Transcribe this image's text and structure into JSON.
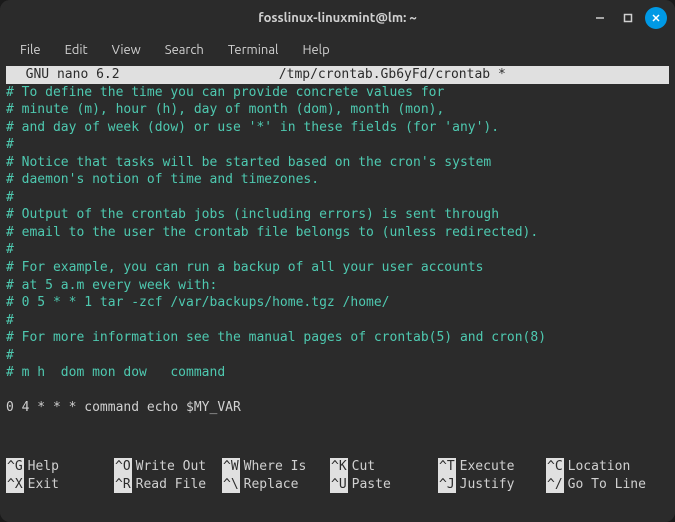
{
  "window": {
    "title": "fosslinux-linuxmint@lm: ~"
  },
  "menubar": {
    "file": "File",
    "edit": "Edit",
    "view": "View",
    "search": "Search",
    "terminal": "Terminal",
    "help": "Help"
  },
  "nano": {
    "version": "  GNU nano 6.2",
    "filepath": "/tmp/crontab.Gb6yFd/crontab *"
  },
  "lines": {
    "l0": "# To define the time you can provide concrete values for",
    "l1": "# minute (m), hour (h), day of month (dom), month (mon),",
    "l2": "# and day of week (dow) or use '*' in these fields (for 'any').",
    "l3": "#",
    "l4": "# Notice that tasks will be started based on the cron's system",
    "l5": "# daemon's notion of time and timezones.",
    "l6": "#",
    "l7": "# Output of the crontab jobs (including errors) is sent through",
    "l8": "# email to the user the crontab file belongs to (unless redirected).",
    "l9": "#",
    "l10": "# For example, you can run a backup of all your user accounts",
    "l11": "# at 5 a.m every week with:",
    "l12": "# 0 5 * * 1 tar -zcf /var/backups/home.tgz /home/",
    "l13": "#",
    "l14": "# For more information see the manual pages of crontab(5) and cron(8)",
    "l15": "#",
    "l16": "# m h  dom mon dow   command",
    "l17": "",
    "l18": "0 4 * * * command echo $MY_VAR"
  },
  "shortcuts": {
    "help_key": "^G",
    "help_desc": "Help",
    "writeout_key": "^O",
    "writeout_desc": "Write Out",
    "whereis_key": "^W",
    "whereis_desc": "Where Is",
    "cut_key": "^K",
    "cut_desc": "Cut",
    "execute_key": "^T",
    "execute_desc": "Execute",
    "location_key": "^C",
    "location_desc": "Location",
    "exit_key": "^X",
    "exit_desc": "Exit",
    "readfile_key": "^R",
    "readfile_desc": "Read File",
    "replace_key": "^\\",
    "replace_desc": "Replace",
    "paste_key": "^U",
    "paste_desc": "Paste",
    "justify_key": "^J",
    "justify_desc": "Justify",
    "gotoline_key": "^/",
    "gotoline_desc": "Go To Line"
  }
}
